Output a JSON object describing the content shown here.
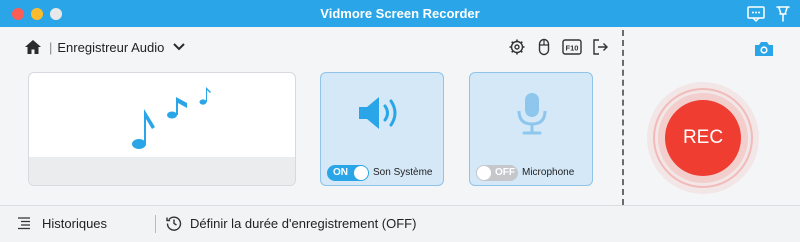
{
  "window": {
    "title": "Vidmore Screen Recorder",
    "colors": {
      "titlebar": "#2aa6e8",
      "close": "#fc5d55",
      "minimize": "#fdbc2e",
      "zoom": "#e8e8e8",
      "accent": "#2aa6e8",
      "rec": "#ef3d32"
    }
  },
  "titlebar_icons": [
    "chat-icon",
    "pin-icon"
  ],
  "header": {
    "home_icon": "home-icon",
    "separator": "|",
    "mode_label": "Enregistreur Audio",
    "dropdown_icon": "chevron-down-icon"
  },
  "toolbar": {
    "icons": [
      "gear-icon",
      "mouse-icon",
      "hotkey-icon",
      "export-icon"
    ],
    "hotkey_text": "F10"
  },
  "camera_icon": "camera-icon",
  "sources": {
    "system": {
      "toggle_text": "ON",
      "state": "on",
      "label": "Son Système",
      "icon": "speaker-icon"
    },
    "microphone": {
      "toggle_text": "OFF",
      "state": "off",
      "label": "Microphone",
      "icon": "microphone-icon"
    }
  },
  "rec_button": {
    "label": "REC"
  },
  "bottom": {
    "history_label": "Historiques",
    "history_icon": "list-icon",
    "schedule_label": "Définir la durée d'enregistrement (OFF)",
    "schedule_icon": "clock-icon"
  }
}
